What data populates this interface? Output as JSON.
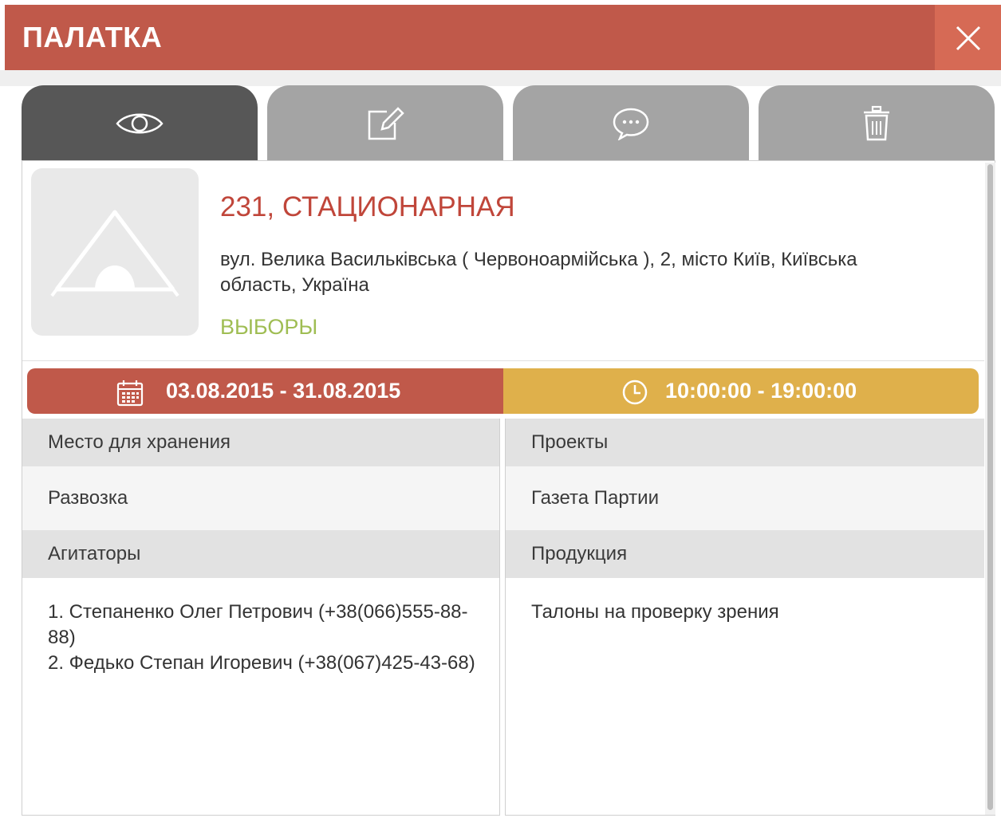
{
  "window": {
    "title": "ПАЛАТКА",
    "close_label": "×"
  },
  "tabs": [
    {
      "icon": "eye-icon",
      "active": true
    },
    {
      "icon": "edit-icon",
      "active": false
    },
    {
      "icon": "comment-icon",
      "active": false
    },
    {
      "icon": "trash-icon",
      "active": false
    }
  ],
  "object": {
    "thumbnail_icon": "tent-icon",
    "title": "231, СТАЦИОНАРНАЯ",
    "address": "вул. Велика Васильківська ( Червоноармійська ), 2, місто Київ, Київська область, Україна",
    "category": "ВЫБОРЫ"
  },
  "schedule": {
    "date_icon": "calendar-icon",
    "date_range": "03.08.2015 - 31.08.2015",
    "time_icon": "clock-icon",
    "time_range": "10:00:00 - 19:00:00"
  },
  "details": {
    "storage_label": "Место для хранения",
    "storage_value": "Развозка",
    "agitators_label": "Агитаторы",
    "agitators": [
      "1. Степаненко Олег Петрович (+38(066)555-88-88)",
      "2. Федько Степан Игоревич (+38(067)425-43-68)"
    ],
    "projects_label": "Проекты",
    "projects_value": "Газета Партии",
    "products_label": "Продукция",
    "products_value": "Талоны на проверку зрения"
  },
  "colors": {
    "header": "#c0594a",
    "close": "#d66a55",
    "tab_active": "#575757",
    "tab_inactive": "#a4a4a4",
    "title_red": "#c0463a",
    "category_green": "#9fbd53",
    "date_bar": "#c0594a",
    "time_bar": "#dfb04b"
  }
}
